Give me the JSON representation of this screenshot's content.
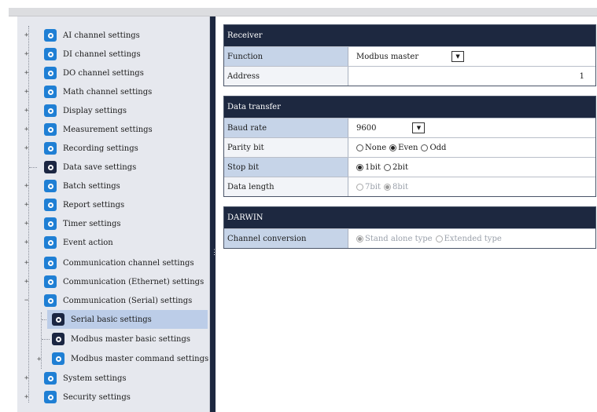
{
  "tree": {
    "items": [
      {
        "label": "AI channel settings",
        "icon": "settings-icon"
      },
      {
        "label": "DI channel settings",
        "icon": "settings-icon"
      },
      {
        "label": "DO channel settings",
        "icon": "settings-icon"
      },
      {
        "label": "Math channel settings",
        "icon": "settings-icon"
      },
      {
        "label": "Display settings",
        "icon": "settings-icon"
      },
      {
        "label": "Measurement settings",
        "icon": "settings-icon"
      },
      {
        "label": "Recording settings",
        "icon": "settings-icon"
      },
      {
        "label": "Data save settings",
        "icon": "settings-icon"
      },
      {
        "label": "Batch settings",
        "icon": "settings-icon"
      },
      {
        "label": "Report settings",
        "icon": "settings-icon"
      },
      {
        "label": "Timer settings",
        "icon": "settings-icon"
      },
      {
        "label": "Event action",
        "icon": "settings-icon"
      },
      {
        "label": "Communication channel settings",
        "icon": "settings-icon"
      },
      {
        "label": "Communication (Ethernet) settings",
        "icon": "settings-icon"
      },
      {
        "label": "Communication (Serial) settings",
        "icon": "settings-icon"
      },
      {
        "label": "Serial basic settings",
        "icon": "settings-icon"
      },
      {
        "label": "Modbus master basic settings",
        "icon": "settings-icon"
      },
      {
        "label": "Modbus master command settings",
        "icon": "settings-icon"
      },
      {
        "label": "System settings",
        "icon": "settings-icon"
      },
      {
        "label": "Security settings",
        "icon": "settings-icon"
      }
    ],
    "selected": "Serial basic settings"
  },
  "receiver": {
    "title": "Receiver",
    "function_label": "Function",
    "function_value": "Modbus master",
    "address_label": "Address",
    "address_value": "1"
  },
  "data_transfer": {
    "title": "Data transfer",
    "baud_label": "Baud rate",
    "baud_value": "9600",
    "parity_label": "Parity bit",
    "parity_options": [
      "None",
      "Even",
      "Odd"
    ],
    "parity_selected": "Even",
    "stop_label": "Stop bit",
    "stop_options": [
      "1bit",
      "2bit"
    ],
    "stop_selected": "1bit",
    "length_label": "Data length",
    "length_options": [
      "7bit",
      "8bit"
    ],
    "length_selected": "8bit"
  },
  "darwin": {
    "title": "DARWIN",
    "channel_label": "Channel conversion",
    "channel_options": [
      "Stand alone type",
      "Extended type"
    ],
    "channel_selected": "Stand alone type"
  },
  "colors": {
    "header": "#1d2840",
    "label_bg": "#c6d4e8",
    "icon_blue": "#1f7fd4",
    "icon_dark": "#1b2642",
    "selected": "#bccde8"
  }
}
